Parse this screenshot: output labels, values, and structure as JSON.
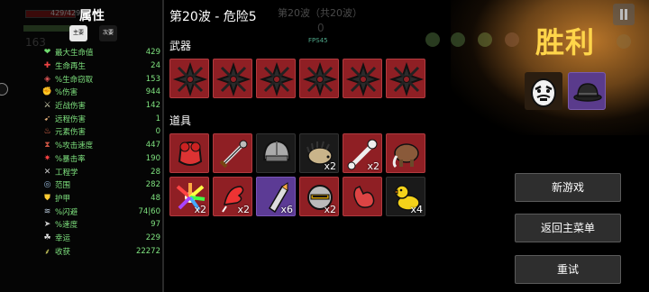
{
  "hud": {
    "hp_text": "429/429",
    "gold_text": "163"
  },
  "stats": {
    "title": "属性",
    "tabs": {
      "primary": "主要",
      "secondary": "次要"
    },
    "rows": [
      {
        "icon": "heart-icon",
        "glyph": "❤",
        "color": "#6fdc6f",
        "label": "最大生命值",
        "value": "429"
      },
      {
        "icon": "health-regen-icon",
        "glyph": "✚",
        "color": "#e44",
        "label": "生命再生",
        "value": "24"
      },
      {
        "icon": "lifesteal-icon",
        "glyph": "◈",
        "color": "#d55",
        "label": "%生命窃取",
        "value": "153"
      },
      {
        "icon": "damage-icon",
        "glyph": "✊",
        "color": "#e77",
        "label": "%伤害",
        "value": "944"
      },
      {
        "icon": "melee-damage-icon",
        "glyph": "⚔",
        "color": "#ddb",
        "label": "近战伤害",
        "value": "142"
      },
      {
        "icon": "ranged-damage-icon",
        "glyph": "➹",
        "color": "#da7",
        "label": "远程伤害",
        "value": "1"
      },
      {
        "icon": "elemental-damage-icon",
        "glyph": "♨",
        "color": "#f75",
        "label": "元素伤害",
        "value": "0"
      },
      {
        "icon": "attack-speed-icon",
        "glyph": "⧗",
        "color": "#c54",
        "label": "%攻击速度",
        "value": "447"
      },
      {
        "icon": "crit-chance-icon",
        "glyph": "✷",
        "color": "#f44",
        "label": "%暴击率",
        "value": "190"
      },
      {
        "icon": "engineering-icon",
        "glyph": "✕",
        "color": "#ccc",
        "label": "工程学",
        "value": "28"
      },
      {
        "icon": "range-icon",
        "glyph": "◎",
        "color": "#9bd",
        "label": "范围",
        "value": "282"
      },
      {
        "icon": "armor-icon",
        "glyph": "⛊",
        "color": "#fc3",
        "label": "护甲",
        "value": "48"
      },
      {
        "icon": "dodge-icon",
        "glyph": "≋",
        "color": "#bcd",
        "label": "%闪避",
        "value": "74|60"
      },
      {
        "icon": "speed-icon",
        "glyph": "➤",
        "color": "#ccc",
        "label": "%速度",
        "value": "97"
      },
      {
        "icon": "luck-icon",
        "glyph": "☘",
        "color": "#eee",
        "label": "幸运",
        "value": "229"
      },
      {
        "icon": "harvesting-icon",
        "glyph": "⸙",
        "color": "#dd6",
        "label": "收获",
        "value": "22272"
      }
    ]
  },
  "wave": {
    "title": "第20波 - 危险5",
    "ghost_title": "第20波（共20波）",
    "ghost_number": "0",
    "fps": "FPS45"
  },
  "weapons": {
    "title": "武器",
    "slots": [
      {
        "icon": "shuriken-icon",
        "tier": "red"
      },
      {
        "icon": "shuriken-icon",
        "tier": "red"
      },
      {
        "icon": "shuriken-icon",
        "tier": "red"
      },
      {
        "icon": "shuriken-icon",
        "tier": "red"
      },
      {
        "icon": "shuriken-icon",
        "tier": "red"
      },
      {
        "icon": "shuriken-icon",
        "tier": "red"
      }
    ]
  },
  "items": {
    "title": "道具",
    "slots": [
      {
        "icon": "red-armor-icon",
        "tier": "red",
        "count": ""
      },
      {
        "icon": "spiked-sword-icon",
        "tier": "red",
        "count": ""
      },
      {
        "icon": "helmet-icon",
        "tier": "dark",
        "count": ""
      },
      {
        "icon": "hedgehog-icon",
        "tier": "dark",
        "count": "x2"
      },
      {
        "icon": "bone-wrench-icon",
        "tier": "red",
        "count": "x2"
      },
      {
        "icon": "mammoth-icon",
        "tier": "red",
        "count": ""
      },
      {
        "icon": "rainbow-feather-icon",
        "tier": "red",
        "count": "x2"
      },
      {
        "icon": "lobster-claw-icon",
        "tier": "red",
        "count": "x2"
      },
      {
        "icon": "missile-icon",
        "tier": "purple",
        "count": "x6"
      },
      {
        "icon": "knight-helmet-icon",
        "tier": "red",
        "count": "x2"
      },
      {
        "icon": "stomach-icon",
        "tier": "red",
        "count": ""
      },
      {
        "icon": "rubber-duck-icon",
        "tier": "dark",
        "count": "x4"
      }
    ]
  },
  "victory": {
    "text": "胜利",
    "color": "#ffd54a"
  },
  "menu": {
    "new_game": "新游戏",
    "main_menu": "返回主菜单",
    "retry": "重试"
  },
  "colors": {
    "stat_green": "#7fe37f",
    "slot_red": "#8f1f24",
    "slot_purple": "#5c3b95",
    "button_bg": "#2e2e2e"
  }
}
